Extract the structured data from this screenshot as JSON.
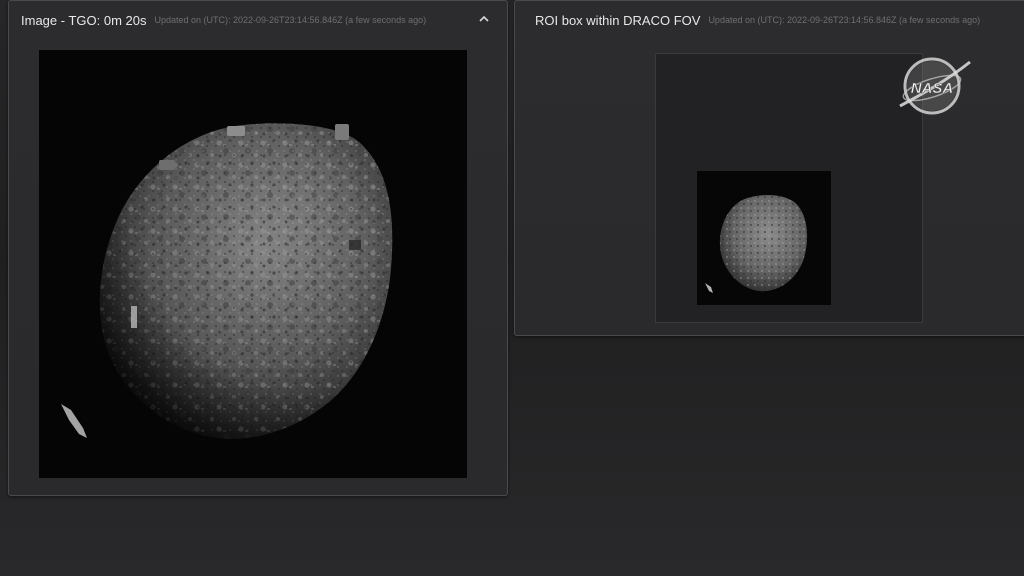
{
  "left_panel": {
    "title": "Image - TGO: 0m 20s",
    "updated": "Updated on (UTC): 2022-09-26T23:14:56.846Z (a few seconds ago)",
    "collapse_icon": "chevron-up-icon",
    "image": "asteroid-dimorphos-closeup"
  },
  "right_panel": {
    "title": "ROI box within DRACO FOV",
    "updated": "Updated on (UTC): 2022-09-26T23:14:56.846Z (a few seconds ago)",
    "image": "asteroid-dimorphos-roi"
  },
  "logo": {
    "text": "NASA",
    "icon": "nasa-meatball-icon"
  },
  "colors": {
    "background": "#1e1e1f",
    "panel": "#2c2c2e",
    "panel_border": "#4a4a4c",
    "title_text": "#e8e8e8",
    "meta_text": "#6f6f72"
  }
}
